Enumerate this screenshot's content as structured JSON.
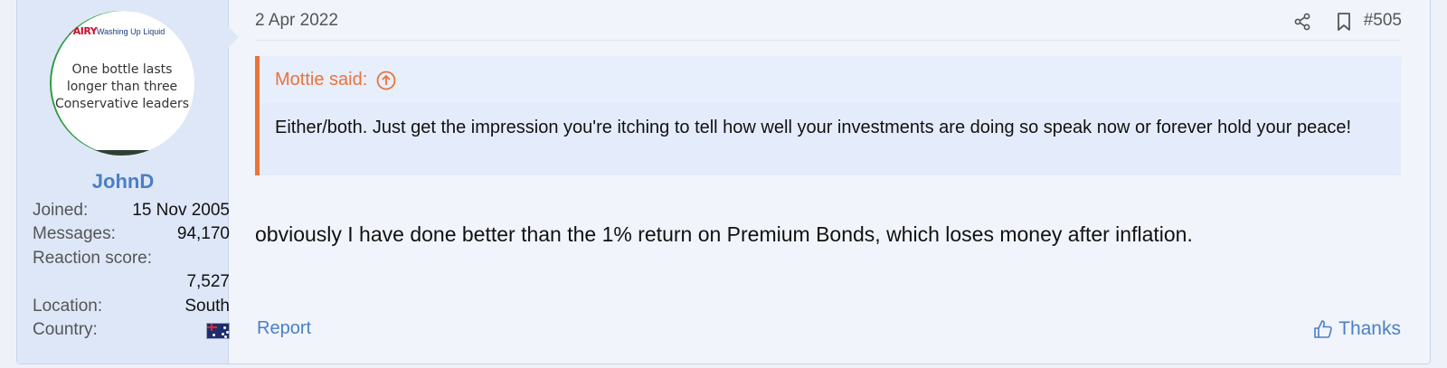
{
  "user": {
    "avatar": {
      "brand": "FAIRY",
      "brand_sub": "Washing Up Liquid",
      "line1": "One bottle lasts",
      "line2": "longer than three",
      "line3": "Conservative leaders"
    },
    "username": "JohnD",
    "joined_label": "Joined:",
    "joined_value": "15 Nov 2005",
    "messages_label": "Messages:",
    "messages_value": "94,170",
    "reaction_label": "Reaction score:",
    "reaction_value": "7,527",
    "location_label": "Location:",
    "location_value": "South",
    "country_label": "Country:",
    "country_flag_icon": "australia-flag-icon"
  },
  "post": {
    "date": "2 Apr 2022",
    "number": "#505",
    "share_icon": "share-icon",
    "bookmark_icon": "bookmark-icon",
    "quote": {
      "author": "Mottie said:",
      "jump_icon": "arrow-up-circle-icon",
      "text": "Either/both. Just get the impression you're itching to tell how well your investments are doing so speak now or forever hold your peace!"
    },
    "message": "obviously I have done better than the 1% return on Premium Bonds, which loses money after inflation.",
    "report_label": "Report",
    "thanks_label": "Thanks",
    "thanks_icon": "thumbs-up-icon"
  },
  "colors": {
    "accent": "#4a7fc6",
    "quote_accent": "#e8743b",
    "user_panel": "#dde7f7",
    "quote_bg": "#e4ecfb"
  }
}
